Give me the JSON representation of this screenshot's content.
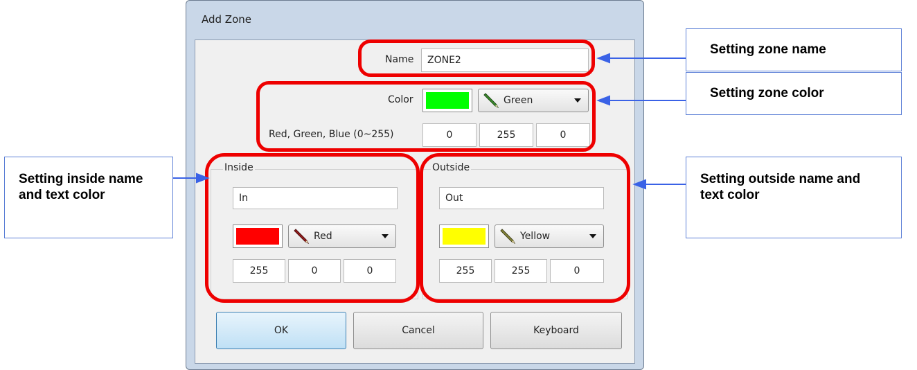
{
  "dialog": {
    "title": "Add Zone",
    "name_label": "Name",
    "name_value": "ZONE2",
    "color_label": "Color",
    "color_combo": "Green",
    "rgb_label": "Red, Green, Blue (0~255)",
    "rgb": [
      "0",
      "255",
      "0"
    ],
    "swatch_color": "#00ff00",
    "inside": {
      "label": "Inside",
      "name": "In",
      "combo": "Red",
      "rgb": [
        "255",
        "0",
        "0"
      ],
      "swatch_color": "#ff0000"
    },
    "outside": {
      "label": "Outside",
      "name": "Out",
      "combo": "Yellow",
      "rgb": [
        "255",
        "255",
        "0"
      ],
      "swatch_color": "#ffff00"
    },
    "buttons": {
      "ok": "OK",
      "cancel": "Cancel",
      "keyboard": "Keyboard"
    }
  },
  "annotations": {
    "zone_name": "Setting zone name",
    "zone_color": "Setting zone color",
    "inside": "Setting inside name and text color",
    "outside": "Setting outside name and text color"
  },
  "colors": {
    "highlight": "#ee0000",
    "arrow": "#3a62e6",
    "callout_border": "#5b7fd6"
  },
  "icons": [
    "pen-icon",
    "dropdown-arrow-icon",
    "connector-arrow-icon"
  ]
}
